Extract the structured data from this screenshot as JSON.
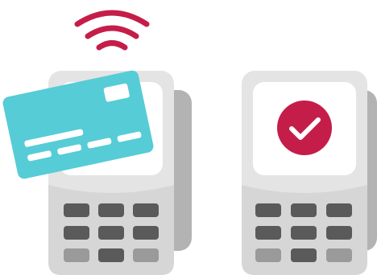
{
  "illustration": {
    "left_terminal": {
      "state": "tap-to-pay",
      "icons": [
        "wifi-contactless-icon",
        "credit-card-icon"
      ],
      "keypad_rows": 3,
      "keypad_cols": 3
    },
    "right_terminal": {
      "state": "payment-approved",
      "icons": [
        "checkmark-icon"
      ],
      "keypad_rows": 3,
      "keypad_cols": 3
    }
  },
  "colors": {
    "accent": "#c51d4a",
    "card": "#56ccd6",
    "terminal_body": "#e4e4e4",
    "terminal_shadow": "#b3b3b3",
    "screen": "#ffffff",
    "key_dark": "#5a5a5a",
    "key_light": "#9a9a9a"
  }
}
